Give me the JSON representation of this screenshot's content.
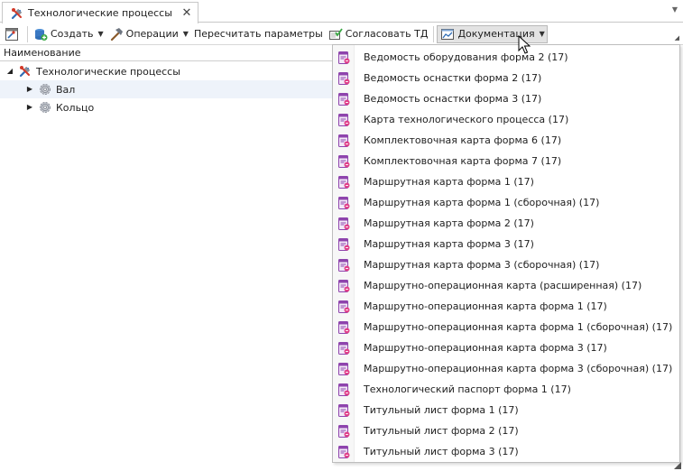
{
  "tab": {
    "title": "Технологические процессы",
    "icon": "tools-icon",
    "close_glyph": "✕"
  },
  "toolbar": {
    "create_label": "Создать",
    "operations_label": "Операции",
    "recalc_label": "Пересчитать параметры",
    "approve_label": "Согласовать ТД",
    "documentation_label": "Документация"
  },
  "column_header": "Наименование",
  "tree": {
    "root_label": "Технологические процессы",
    "children": [
      {
        "label": "Вал"
      },
      {
        "label": "Кольцо"
      }
    ]
  },
  "dropdown": {
    "items": [
      "Ведомость оборудования форма 2 (17)",
      "Ведомость оснастки форма 2 (17)",
      "Ведомость оснастки форма 3 (17)",
      "Карта технологического процесса (17)",
      "Комплектовочная карта форма 6 (17)",
      "Комплектовочная карта форма 7 (17)",
      "Маршрутная карта форма 1 (17)",
      "Маршрутная карта форма 1 (сборочная) (17)",
      "Маршрутная карта форма 2 (17)",
      "Маршрутная карта форма 3 (17)",
      "Маршрутная карта форма 3 (сборочная) (17)",
      "Маршрутно-операционная карта (расширенная) (17)",
      "Маршрутно-операционная карта форма 1 (17)",
      "Маршрутно-операционная карта форма 1 (сборочная) (17)",
      "Маршрутно-операционная карта форма 3 (17)",
      "Маршрутно-операционная карта форма 3 (сборочная) (17)",
      "Технологический паспорт форма 1 (17)",
      "Титульный лист форма 1 (17)",
      "Титульный лист форма 2 (17)",
      "Титульный лист форма 3 (17)"
    ]
  },
  "colors": {
    "accent_blue": "#2f6db5",
    "report_purple": "#8e44ad",
    "report_pink": "#e0408a",
    "tools_red": "#d23a2a",
    "gear_gray": "#8a8f99"
  }
}
